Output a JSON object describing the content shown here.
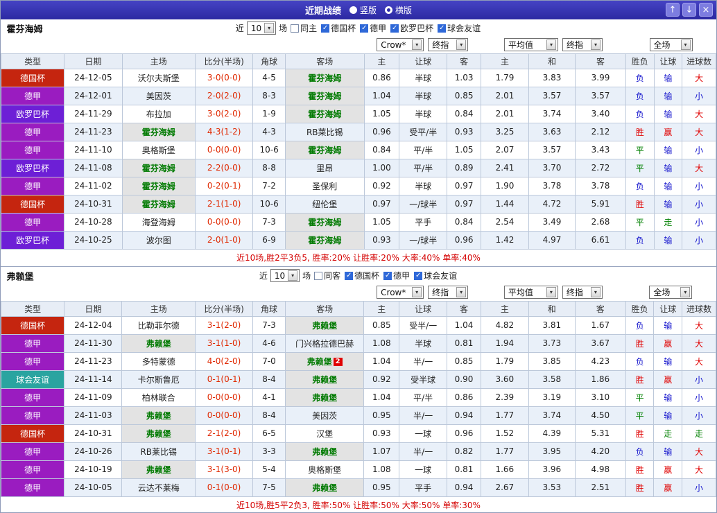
{
  "titlebar": {
    "title": "近期战绩",
    "layout_options": [
      {
        "label": "竖版",
        "selected": false
      },
      {
        "label": "横版",
        "selected": true
      }
    ],
    "window_buttons": [
      {
        "name": "move-up",
        "glyph": "↑"
      },
      {
        "name": "move-down",
        "glyph": "↓"
      },
      {
        "name": "close",
        "glyph": "×"
      }
    ]
  },
  "table_headers": {
    "main": [
      "类型",
      "日期",
      "主场",
      "比分(半场)",
      "角球",
      "客场"
    ],
    "sub": [
      "主",
      "让球",
      "客",
      "主",
      "和",
      "客",
      "胜负",
      "让球",
      "进球数"
    ]
  },
  "type_colors": {
    "德国杯": "#c5250f",
    "德甲": "#9a1cc0",
    "欧罗巴杯": "#6d1fd6",
    "球会友谊": "#2aa4a0"
  },
  "result_colors": {
    "胜": "#e00000",
    "赢": "#e00000",
    "大": "#e00000",
    "平": "#008000",
    "走": "#008000",
    "负": "#1515cd",
    "输": "#1515cd",
    "小": "#1515cd"
  },
  "sections": [
    {
      "team": "霍芬海姆",
      "filter": {
        "prefix": "近",
        "count_select": "10",
        "suffix": "场",
        "venue_checkbox": {
          "label": "同主",
          "checked": false
        },
        "league_checkboxes": [
          {
            "label": "德国杯",
            "checked": true
          },
          {
            "label": "德甲",
            "checked": true
          },
          {
            "label": "欧罗巴杯",
            "checked": true
          },
          {
            "label": "球会友谊",
            "checked": true
          }
        ]
      },
      "selects": {
        "handicap_company": "Crow*",
        "handicap_stage": "终指",
        "europe_company": "平均值",
        "europe_stage": "终指",
        "scope": "全场"
      },
      "rows": [
        {
          "type": "德国杯",
          "date": "24-12-05",
          "home": "沃尔夫斯堡",
          "score": "3-0(0-0)",
          "corner": "4-5",
          "away": "霍芬海姆",
          "focus": "away",
          "ah": [
            "0.86",
            "半球",
            "1.03"
          ],
          "eu": [
            "1.79",
            "3.83",
            "3.99"
          ],
          "results": [
            "负",
            "输",
            "大"
          ]
        },
        {
          "type": "德甲",
          "date": "24-12-01",
          "home": "美因茨",
          "score": "2-0(2-0)",
          "corner": "8-3",
          "away": "霍芬海姆",
          "focus": "away",
          "ah": [
            "1.04",
            "半球",
            "0.85"
          ],
          "eu": [
            "2.01",
            "3.57",
            "3.57"
          ],
          "results": [
            "负",
            "输",
            "小"
          ]
        },
        {
          "type": "欧罗巴杯",
          "date": "24-11-29",
          "home": "布拉加",
          "score": "3-0(2-0)",
          "corner": "1-9",
          "away": "霍芬海姆",
          "focus": "away",
          "ah": [
            "1.05",
            "半球",
            "0.84"
          ],
          "eu": [
            "2.01",
            "3.74",
            "3.40"
          ],
          "results": [
            "负",
            "输",
            "大"
          ]
        },
        {
          "type": "德甲",
          "date": "24-11-23",
          "home": "霍芬海姆",
          "score": "4-3(1-2)",
          "corner": "4-3",
          "away": "RB莱比锡",
          "focus": "home",
          "ah": [
            "0.96",
            "受平/半",
            "0.93"
          ],
          "eu": [
            "3.25",
            "3.63",
            "2.12"
          ],
          "results": [
            "胜",
            "赢",
            "大"
          ]
        },
        {
          "type": "德甲",
          "date": "24-11-10",
          "home": "奥格斯堡",
          "score": "0-0(0-0)",
          "corner": "10-6",
          "away": "霍芬海姆",
          "focus": "away",
          "ah": [
            "0.84",
            "平/半",
            "1.05"
          ],
          "eu": [
            "2.07",
            "3.57",
            "3.43"
          ],
          "results": [
            "平",
            "输",
            "小"
          ]
        },
        {
          "type": "欧罗巴杯",
          "date": "24-11-08",
          "home": "霍芬海姆",
          "score": "2-2(0-0)",
          "corner": "8-8",
          "away": "里昂",
          "focus": "home",
          "ah": [
            "1.00",
            "平/半",
            "0.89"
          ],
          "eu": [
            "2.41",
            "3.70",
            "2.72"
          ],
          "results": [
            "平",
            "输",
            "大"
          ]
        },
        {
          "type": "德甲",
          "date": "24-11-02",
          "home": "霍芬海姆",
          "score": "0-2(0-1)",
          "corner": "7-2",
          "away": "圣保利",
          "focus": "home",
          "ah": [
            "0.92",
            "半球",
            "0.97"
          ],
          "eu": [
            "1.90",
            "3.78",
            "3.78"
          ],
          "results": [
            "负",
            "输",
            "小"
          ]
        },
        {
          "type": "德国杯",
          "date": "24-10-31",
          "home": "霍芬海姆",
          "score": "2-1(1-0)",
          "corner": "10-6",
          "away": "纽伦堡",
          "focus": "home",
          "ah": [
            "0.97",
            "一/球半",
            "0.97"
          ],
          "eu": [
            "1.44",
            "4.72",
            "5.91"
          ],
          "results": [
            "胜",
            "输",
            "小"
          ]
        },
        {
          "type": "德甲",
          "date": "24-10-28",
          "home": "海登海姆",
          "score": "0-0(0-0)",
          "corner": "7-3",
          "away": "霍芬海姆",
          "focus": "away",
          "ah": [
            "1.05",
            "平手",
            "0.84"
          ],
          "eu": [
            "2.54",
            "3.49",
            "2.68"
          ],
          "results": [
            "平",
            "走",
            "小"
          ]
        },
        {
          "type": "欧罗巴杯",
          "date": "24-10-25",
          "home": "波尔图",
          "score": "2-0(1-0)",
          "corner": "6-9",
          "away": "霍芬海姆",
          "focus": "away",
          "ah": [
            "0.93",
            "一/球半",
            "0.96"
          ],
          "eu": [
            "1.42",
            "4.97",
            "6.61"
          ],
          "results": [
            "负",
            "输",
            "小"
          ]
        }
      ],
      "summary": "近10场,胜2平3负5, 胜率:20% 让胜率:20% 大率:40% 单率:40%"
    },
    {
      "team": "弗赖堡",
      "filter": {
        "prefix": "近",
        "count_select": "10",
        "suffix": "场",
        "venue_checkbox": {
          "label": "同客",
          "checked": false
        },
        "league_checkboxes": [
          {
            "label": "德国杯",
            "checked": true
          },
          {
            "label": "德甲",
            "checked": true
          },
          {
            "label": "球会友谊",
            "checked": true
          }
        ]
      },
      "selects": {
        "handicap_company": "Crow*",
        "handicap_stage": "终指",
        "europe_company": "平均值",
        "europe_stage": "终指",
        "scope": "全场"
      },
      "rows": [
        {
          "type": "德国杯",
          "date": "24-12-04",
          "home": "比勒菲尔德",
          "score": "3-1(2-0)",
          "corner": "7-3",
          "away": "弗赖堡",
          "focus": "away",
          "ah": [
            "0.85",
            "受半/一",
            "1.04"
          ],
          "eu": [
            "4.82",
            "3.81",
            "1.67"
          ],
          "results": [
            "负",
            "输",
            "大"
          ]
        },
        {
          "type": "德甲",
          "date": "24-11-30",
          "home": "弗赖堡",
          "score": "3-1(1-0)",
          "corner": "4-6",
          "away": "门兴格拉德巴赫",
          "focus": "home",
          "ah": [
            "1.08",
            "半球",
            "0.81"
          ],
          "eu": [
            "1.94",
            "3.73",
            "3.67"
          ],
          "results": [
            "胜",
            "赢",
            "大"
          ]
        },
        {
          "type": "德甲",
          "date": "24-11-23",
          "home": "多特蒙德",
          "score": "4-0(2-0)",
          "corner": "7-0",
          "away": "弗赖堡",
          "away_badge": "2",
          "focus": "away",
          "ah": [
            "1.04",
            "半/一",
            "0.85"
          ],
          "eu": [
            "1.79",
            "3.85",
            "4.23"
          ],
          "results": [
            "负",
            "输",
            "大"
          ]
        },
        {
          "type": "球会友谊",
          "date": "24-11-14",
          "home": "卡尔斯鲁厄",
          "score": "0-1(0-1)",
          "corner": "8-4",
          "away": "弗赖堡",
          "focus": "away",
          "ah": [
            "0.92",
            "受半球",
            "0.90"
          ],
          "eu": [
            "3.60",
            "3.58",
            "1.86"
          ],
          "results": [
            "胜",
            "赢",
            "小"
          ]
        },
        {
          "type": "德甲",
          "date": "24-11-09",
          "home": "柏林联合",
          "score": "0-0(0-0)",
          "corner": "4-1",
          "away": "弗赖堡",
          "focus": "away",
          "ah": [
            "1.04",
            "平/半",
            "0.86"
          ],
          "eu": [
            "2.39",
            "3.19",
            "3.10"
          ],
          "results": [
            "平",
            "输",
            "小"
          ]
        },
        {
          "type": "德甲",
          "date": "24-11-03",
          "home": "弗赖堡",
          "score": "0-0(0-0)",
          "corner": "8-4",
          "away": "美因茨",
          "focus": "home",
          "ah": [
            "0.95",
            "半/一",
            "0.94"
          ],
          "eu": [
            "1.77",
            "3.74",
            "4.50"
          ],
          "results": [
            "平",
            "输",
            "小"
          ]
        },
        {
          "type": "德国杯",
          "date": "24-10-31",
          "home": "弗赖堡",
          "score": "2-1(2-0)",
          "corner": "6-5",
          "away": "汉堡",
          "focus": "home",
          "ah": [
            "0.93",
            "一球",
            "0.96"
          ],
          "eu": [
            "1.52",
            "4.39",
            "5.31"
          ],
          "results": [
            "胜",
            "走",
            "走"
          ]
        },
        {
          "type": "德甲",
          "date": "24-10-26",
          "home": "RB莱比锡",
          "score": "3-1(0-1)",
          "corner": "3-3",
          "away": "弗赖堡",
          "focus": "away",
          "ah": [
            "1.07",
            "半/一",
            "0.82"
          ],
          "eu": [
            "1.77",
            "3.95",
            "4.20"
          ],
          "results": [
            "负",
            "输",
            "大"
          ]
        },
        {
          "type": "德甲",
          "date": "24-10-19",
          "home": "弗赖堡",
          "score": "3-1(3-0)",
          "corner": "5-4",
          "away": "奥格斯堡",
          "focus": "home",
          "ah": [
            "1.08",
            "一球",
            "0.81"
          ],
          "eu": [
            "1.66",
            "3.96",
            "4.98"
          ],
          "results": [
            "胜",
            "赢",
            "大"
          ]
        },
        {
          "type": "德甲",
          "date": "24-10-05",
          "home": "云达不莱梅",
          "score": "0-1(0-0)",
          "corner": "7-5",
          "away": "弗赖堡",
          "focus": "away",
          "ah": [
            "0.95",
            "平手",
            "0.94"
          ],
          "eu": [
            "2.67",
            "3.53",
            "2.51"
          ],
          "results": [
            "胜",
            "赢",
            "小"
          ]
        }
      ],
      "summary": "近10场,胜5平2负3, 胜率:50% 让胜率:50% 大率:50% 单率:30%"
    }
  ]
}
